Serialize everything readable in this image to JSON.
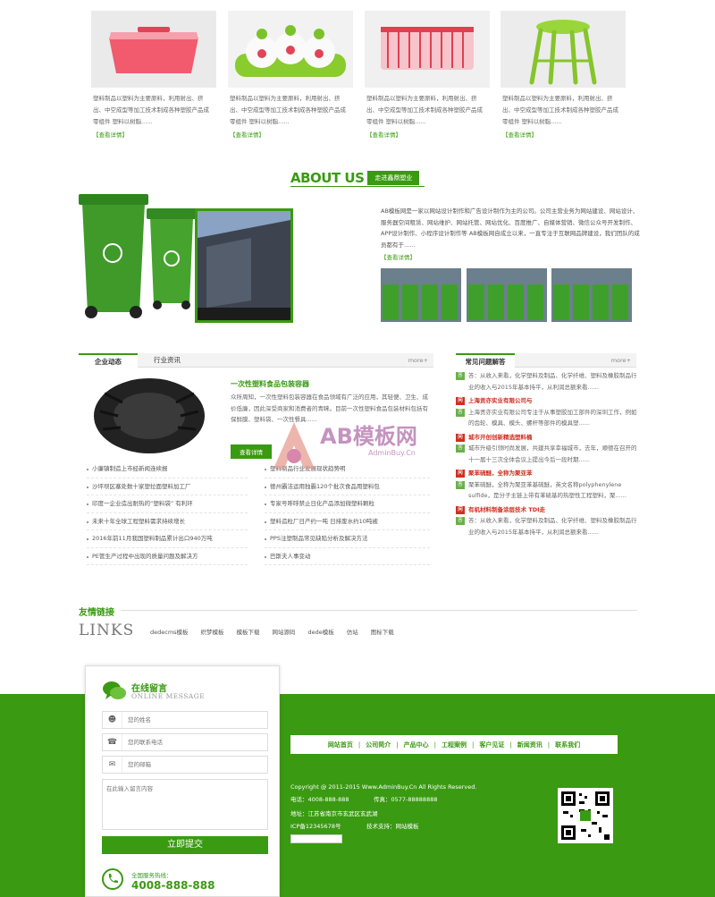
{
  "products": [
    {
      "desc": "塑料制品以塑料为主要原料，利用射出、挤出、中空成型等加工技术制成各种塑胶产品成零组件 塑料以树脂......",
      "more": "【查看详情】"
    },
    {
      "desc": "塑料制品以塑料为主要原料，利用射出、挤出、中空成型等加工技术制成各种塑胶产品成零组件 塑料以树脂......",
      "more": "【查看详情】"
    },
    {
      "desc": "塑料制品以塑料为主要原料，利用射出、挤出、中空成型等加工技术制成各种塑胶产品成零组件 塑料以树脂......",
      "more": "【查看详情】"
    },
    {
      "desc": "塑料制品以塑料为主要原料，利用射出、挤出、中空成型等加工技术制成各种塑胶产品成零组件 塑料以树脂......",
      "more": "【查看详情】"
    }
  ],
  "about": {
    "title_en": "ABOUT US",
    "title_cn": "走进鑫鼎塑业",
    "text": "AB模板网是一家以网站设计制作和广告设计制作为主的公司。公司主营业务为网站建设、网站设计、服务器空间租赁、网站维护、网站托管、网站优化、百度推广、自媒体营销、微信公众号开发制作、APP设计制作、小程序设计制作等 AB模板网自成立以来，一直专注于互联网品牌建设，我们团队的成员都有于......",
    "more": "【查看详情】"
  },
  "news": {
    "tabs": [
      "企业动态",
      "行业资讯"
    ],
    "more": "more+",
    "feature_title": "一次性塑料食品包装容器",
    "feature_text": "众所周知，一次性塑料包装容器在食品领域有广泛的应用，其轻便、卫生、成价低廉，因此深受商家和消费者的青睐。目前一次性塑料食品包装材料包括有保鲜膜、塑料袋、一次性餐具......",
    "feature_button": "查看详情",
    "left_list": [
      "小廉镇制造上市经新闻连续报",
      "沙坪坝区塞处数十家塑拉面塑料加工厂",
      "印度一企业造出耐热的“塑料袋” 有利环",
      "未来十年全球工程塑料需求持续增长",
      "2016年前11月我国塑料制品累计出口940万吨",
      "PE管生产过程中出现的质量问题及解决方"
    ],
    "right_list": [
      "塑料制品行业发展现状趋势明",
      "德州霸洁运用独霸120个批次食品用塑料包",
      "专家号呼呼禁止日化产品添加微塑料颗粒",
      "塑料造粒厂日产约一吨 日排废水约10吨被",
      "PPS注塑制品常见缺陷分析及解决方法",
      "巴斯夫人事变动"
    ]
  },
  "faq": {
    "title": "常见问题解答",
    "more": "more+",
    "items": [
      {
        "a": "答：从收入来看，化学塑料及制品、化学纤维、塑料及橡胶制品行业的收入与2015年基本持平，从利润总额来看......"
      },
      {
        "q": "上海贡亦实业有限公司与",
        "a": "上海贡亦实业有限公司专注于从事塑胶加工部件的深圳工作，例如的齿轮、模具、模头、螺杆等部件的模具塑......"
      },
      {
        "q": "城市开创创新精选塑料桶",
        "a": "城市升级引领时尚发展，共建共享幸福城市，去年，顺德在召开的十一届十三次全体会议上提出今后一段时期......"
      },
      {
        "q": "聚苯硫醚，全称为聚亚苯",
        "a": "聚苯硫醚，全称为聚亚苯基硫醚，英文名称polyphenylene sulfide，是分子主链上带有苯硫基的热塑性工程塑料，聚......"
      },
      {
        "q": "有机材料制备涂层技术 TDI走",
        "a": "答：从收入来看，化学塑料及制品、化学纤维、塑料及橡胶制品行业的收入与2015年基本持平，从利润总额来看......"
      }
    ]
  },
  "links": {
    "title": "友情链接",
    "title_en": "LINKS",
    "items": [
      "dedecms模板",
      "织梦模板",
      "模板下载",
      "网站源码",
      "dede模板",
      "仿站",
      "图标下载"
    ]
  },
  "message": {
    "title": "在线留言",
    "subtitle": "ONLINE MESSAGE",
    "name_ph": "您的姓名",
    "phone_ph": "您的联系电话",
    "email_ph": "您的邮箱",
    "content_ph": "在此输入留言内容",
    "submit": "立即提交",
    "hotline_label": "全国服务热线：",
    "hotline": "4008-888-888"
  },
  "footer": {
    "nav": [
      "网站首页",
      "公司简介",
      "产品中心",
      "工程案例",
      "客户见证",
      "新闻资讯",
      "联系我们"
    ],
    "copyright": "Copyright @ 2011-2015 Www.AdminBuy.Cn All Rights Reserved.",
    "phone": "电话：4008-888-888",
    "fax": "传真：0577-88888888",
    "address": "地址：江苏省南京市玄武区玄武湖",
    "icp": "ICP备12345678号",
    "support": "技术支持：网站模板"
  },
  "watermark": {
    "text": "AB模板网",
    "url": "AdminBuy.Cn"
  },
  "colors": {
    "brand": "#3a9a12",
    "accent_red": "#d03020"
  }
}
